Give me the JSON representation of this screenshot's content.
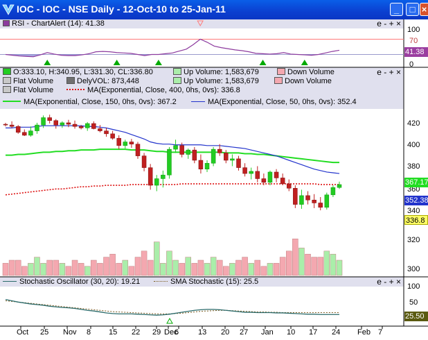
{
  "window": {
    "title": "IOC - IOC - NSE Daily - 12-Oct-10 to 25-Jan-11"
  },
  "controls": {
    "minus": "e",
    "dash": "-",
    "plus": "+",
    "close": "×"
  },
  "rsi": {
    "label": "RSI - ChartAlert (14): 41.38",
    "value_badge": "41.38",
    "ticks": [
      "100",
      "70",
      "0"
    ],
    "line": [
      30,
      28,
      26,
      25,
      24,
      29,
      35,
      31,
      28,
      27,
      27,
      29,
      32,
      37,
      38,
      37,
      35,
      34,
      33,
      30,
      27,
      30,
      30,
      32,
      34,
      39,
      44,
      56,
      70,
      62,
      52,
      48,
      45,
      42,
      40,
      37,
      33,
      32,
      31,
      32,
      35,
      31,
      30,
      29,
      28,
      30,
      34,
      38,
      41
    ],
    "signals": [
      "up-arrow",
      "up-arrow",
      "up-arrow",
      "up-arrow",
      "up-arrow",
      "down-arrow"
    ],
    "colors": {
      "line": "#8d3b9e",
      "fill": "#8080d0",
      "arrow": "#00aa00",
      "overbought": "#ff7a7a",
      "badge": "#9b3ea0"
    }
  },
  "price": {
    "legend": {
      "ohlc": "O:333.10, H:340.95, L:331.30, CL:336.80",
      "up_volume_1": "Up Volume: 1,583,679",
      "down_volume_1": "Down Volume",
      "flat_volume_1": "Flat Volume",
      "dely_vol": "DelyVOL: 873,448",
      "up_volume_2": "Up Volume: 1,583,679",
      "down_volume_2": "Down Volume",
      "flat_volume_2": "Flat Volume",
      "ma400": "MA(Exponential, Close, 400, 0hs, 0vs): 336.8",
      "ma150": "MA(Exponential, Close, 150, 0hs, 0vs): 367.2",
      "ma50": "MA(Exponential, Close, 50, 0hs, 0vs): 352.4"
    },
    "ticks": [
      "420",
      "400",
      "380",
      "360",
      "340",
      "320",
      "300"
    ],
    "badges": {
      "ma150": "367.17",
      "ma50": "352.38",
      "close": "336.8"
    },
    "chart_data": {
      "type": "candlestick",
      "ylim": [
        295,
        432
      ],
      "candles": [
        [
          419,
          421,
          416,
          418
        ],
        [
          418,
          423,
          414,
          416
        ],
        [
          416,
          418,
          406,
          408
        ],
        [
          408,
          412,
          403,
          404
        ],
        [
          404,
          416,
          402,
          410
        ],
        [
          410,
          421,
          406,
          418
        ],
        [
          418,
          431,
          414,
          428
        ],
        [
          428,
          432,
          420,
          424
        ],
        [
          424,
          426,
          413,
          418
        ],
        [
          418,
          423,
          414,
          421
        ],
        [
          421,
          425,
          415,
          419
        ],
        [
          419,
          424,
          413,
          416
        ],
        [
          416,
          418,
          412,
          414
        ],
        [
          414,
          422,
          410,
          420
        ],
        [
          420,
          423,
          412,
          413
        ],
        [
          413,
          418,
          408,
          410
        ],
        [
          410,
          414,
          402,
          406
        ],
        [
          406,
          410,
          398,
          400
        ],
        [
          400,
          404,
          385,
          390
        ],
        [
          390,
          398,
          386,
          395
        ],
        [
          395,
          399,
          387,
          392
        ],
        [
          392,
          395,
          372,
          376
        ],
        [
          376,
          380,
          355,
          360
        ],
        [
          360,
          365,
          330,
          336
        ],
        [
          336,
          350,
          328,
          345
        ],
        [
          345,
          356,
          333,
          350
        ],
        [
          350,
          388,
          345,
          385
        ],
        [
          385,
          398,
          380,
          390
        ],
        [
          390,
          394,
          374,
          378
        ],
        [
          378,
          386,
          372,
          384
        ],
        [
          384,
          388,
          366,
          370
        ],
        [
          370,
          378,
          352,
          358
        ],
        [
          358,
          370,
          354,
          366
        ],
        [
          366,
          388,
          362,
          385
        ],
        [
          385,
          392,
          376,
          380
        ],
        [
          380,
          384,
          366,
          370
        ],
        [
          370,
          378,
          362,
          372
        ],
        [
          372,
          376,
          356,
          360
        ],
        [
          360,
          366,
          348,
          352
        ],
        [
          352,
          360,
          344,
          355
        ],
        [
          355,
          362,
          340,
          345
        ],
        [
          345,
          352,
          336,
          340
        ],
        [
          340,
          356,
          336,
          354
        ],
        [
          354,
          358,
          340,
          346
        ],
        [
          346,
          352,
          336,
          338
        ],
        [
          338,
          344,
          328,
          332
        ],
        [
          332,
          336,
          305,
          310
        ],
        [
          310,
          330,
          304,
          322
        ],
        [
          322,
          328,
          310,
          316
        ],
        [
          316,
          324,
          305,
          312
        ],
        [
          312,
          320,
          302,
          306
        ],
        [
          306,
          326,
          303,
          323
        ],
        [
          323,
          336,
          320,
          333
        ],
        [
          333,
          341,
          331,
          337
        ]
      ],
      "volume": [
        4,
        5,
        5,
        3,
        4,
        6,
        4,
        5,
        5,
        4,
        3,
        5,
        4,
        3,
        5,
        4,
        6,
        7,
        4,
        5,
        3,
        6,
        8,
        5,
        11,
        4,
        8,
        5,
        4,
        6,
        4,
        5,
        4,
        6,
        5,
        3,
        4,
        5,
        6,
        4,
        5,
        3,
        4,
        4,
        6,
        8,
        12,
        9,
        7,
        6,
        6,
        8,
        7,
        5
      ],
      "ma150": [
        377,
        377,
        378,
        378,
        379,
        380,
        381,
        381,
        382,
        382,
        383,
        383,
        384,
        384,
        384,
        385,
        385,
        385,
        385,
        385,
        384,
        384,
        384,
        383,
        382,
        382,
        381,
        381,
        381,
        381,
        381,
        381,
        381,
        381,
        381,
        380,
        380,
        380,
        379,
        379,
        378,
        378,
        377,
        376,
        375,
        374,
        373,
        372,
        371,
        370,
        369,
        368,
        367,
        367
      ],
      "ma50": [
        414,
        414,
        415,
        415,
        415,
        416,
        417,
        417,
        417,
        417,
        417,
        417,
        417,
        416,
        416,
        415,
        414,
        412,
        410,
        408,
        405,
        402,
        399,
        395,
        393,
        392,
        392,
        391,
        391,
        391,
        391,
        391,
        390,
        390,
        390,
        389,
        388,
        387,
        386,
        384,
        382,
        380,
        378,
        376,
        373,
        370,
        367,
        364,
        361,
        358,
        356,
        354,
        353,
        352
      ],
      "ma400": [
        323,
        324,
        325,
        326,
        327,
        328,
        329,
        330,
        331,
        331,
        332,
        333,
        334,
        334,
        335,
        335,
        336,
        336,
        336,
        336,
        337,
        337,
        337,
        337,
        337,
        337,
        337,
        337,
        338,
        338,
        338,
        338,
        338,
        338,
        338,
        338,
        338,
        338,
        338,
        338,
        338,
        338,
        338,
        338,
        338,
        338,
        338,
        338,
        338,
        338,
        337,
        337,
        337,
        337
      ]
    },
    "colors": {
      "up": "#22cc22",
      "down": "#c02020",
      "ma150": "#22dd22",
      "ma50": "#2233cc",
      "ma400": "#dd1111",
      "up_vol": "#aaeeaa",
      "down_vol": "#f4a8b0"
    }
  },
  "stoch": {
    "label": "Stochastic Oscillator (30, 20): 19.21",
    "sma_label": "SMA Stochastic (15): 25.5",
    "value_badge": "25.50",
    "ticks": [
      "100",
      "50",
      "0"
    ],
    "line": [
      66,
      62,
      58,
      55,
      52,
      50,
      48,
      45,
      43,
      41,
      40,
      38,
      35,
      32,
      30,
      27,
      24,
      22,
      21,
      21,
      21,
      20,
      19,
      18,
      17,
      18,
      20,
      23,
      26,
      29,
      32,
      34,
      35,
      35,
      34,
      32,
      30,
      28,
      26,
      26,
      25,
      25,
      25,
      24,
      24,
      23,
      22,
      21,
      20,
      20,
      19,
      19,
      19,
      19
    ],
    "sma": [
      62,
      60,
      58,
      56,
      54,
      52,
      50,
      48,
      46,
      44,
      42,
      40,
      38,
      36,
      34,
      32,
      30,
      28,
      27,
      26,
      25,
      24,
      23,
      22,
      21,
      21,
      21,
      22,
      23,
      25,
      27,
      29,
      30,
      31,
      32,
      32,
      31,
      30,
      29,
      28,
      27,
      27,
      26,
      26,
      25,
      25,
      25,
      25,
      25,
      25,
      25,
      25,
      25,
      25
    ],
    "colors": {
      "line": "#2a6a6a",
      "sma": "#7a5a20",
      "badge": "#5a5a10",
      "marker": "#00aa00"
    }
  },
  "xaxis": {
    "labels": [
      "Oct",
      "25",
      "Nov",
      "8",
      "15",
      "22",
      "29",
      "Dec",
      "6",
      "13",
      "20",
      "27",
      "Jan",
      "10",
      "17",
      "24",
      "Feb",
      "7"
    ]
  }
}
